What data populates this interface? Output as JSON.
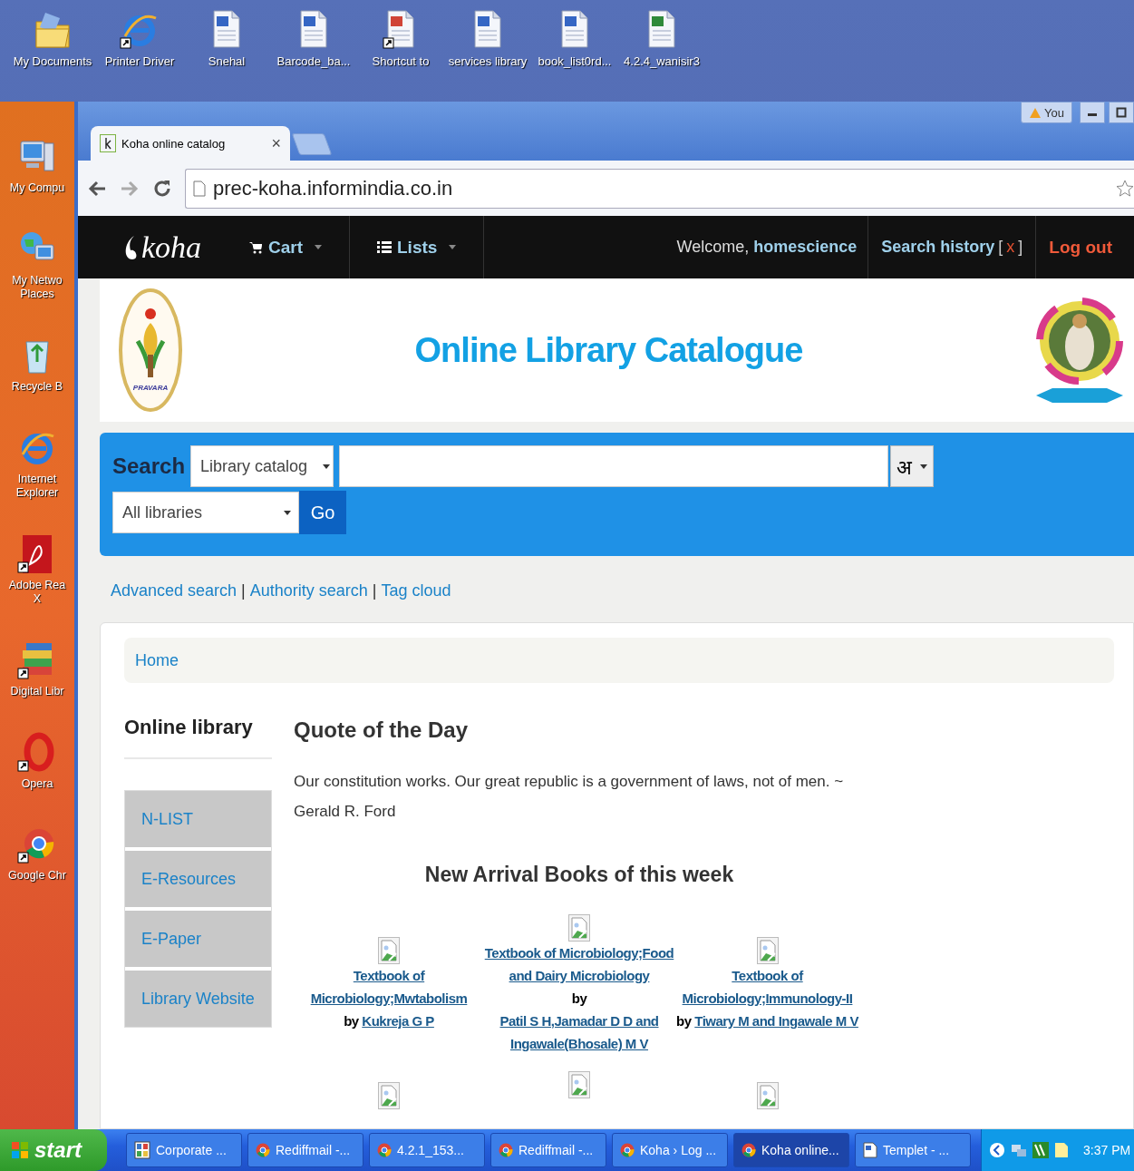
{
  "desktop": {
    "top_icons": [
      {
        "label": "My Documents",
        "kind": "folder",
        "shortcut": false
      },
      {
        "label": "Printer Driver",
        "kind": "ie",
        "shortcut": true
      },
      {
        "label": "Snehal",
        "kind": "word",
        "shortcut": false
      },
      {
        "label": "Barcode_ba...",
        "kind": "word",
        "shortcut": false
      },
      {
        "label": "Shortcut to",
        "kind": "ppt",
        "shortcut": true
      },
      {
        "label": "services library",
        "kind": "word",
        "shortcut": false
      },
      {
        "label": "book_list0rd...",
        "kind": "word",
        "shortcut": false
      },
      {
        "label": "4.2.4_wanisir3",
        "kind": "excel",
        "shortcut": false
      }
    ],
    "side_icons": [
      {
        "label": "My Compu",
        "kind": "computer",
        "shortcut": false
      },
      {
        "label": "My Netwo Places",
        "kind": "network",
        "shortcut": false
      },
      {
        "label": "Recycle B",
        "kind": "recycle",
        "shortcut": false
      },
      {
        "label": "Internet Explorer",
        "kind": "ie",
        "shortcut": false
      },
      {
        "label": "Adobe Rea X",
        "kind": "acrobat",
        "shortcut": true
      },
      {
        "label": "Digital Libr",
        "kind": "books",
        "shortcut": true
      },
      {
        "label": "Opera",
        "kind": "opera",
        "shortcut": true
      },
      {
        "label": "Google Chr",
        "kind": "chrome",
        "shortcut": true
      }
    ]
  },
  "browser": {
    "tab": {
      "title": "Koha online catalog",
      "close": "×",
      "selected": true
    },
    "profile": "You",
    "url": "prec-koha.informindia.co.in"
  },
  "navbar": {
    "logo": "koha",
    "menus": [
      {
        "label": "Cart",
        "kind": "cart"
      },
      {
        "label": "Lists",
        "kind": "list"
      }
    ],
    "welcome": "Welcome,",
    "user": "homescience",
    "search_history": "Search history",
    "history_open": "[",
    "history_clear": "x",
    "history_close": "]",
    "logout": "Log out"
  },
  "header": {
    "title": "Online Library Catalogue",
    "logo_text": "PRAVARA"
  },
  "search": {
    "label": "Search",
    "scope": "Library catalog",
    "keyboard": "अ",
    "library": "All libraries",
    "go": "Go"
  },
  "links": [
    {
      "kind": "link",
      "text": "Advanced search"
    },
    {
      "kind": "separator",
      "text": "|"
    },
    {
      "kind": "link",
      "text": "Authority search"
    },
    {
      "kind": "separator",
      "text": "|"
    },
    {
      "kind": "link",
      "text": "Tag cloud"
    }
  ],
  "breadcrumb": "Home",
  "sidebar": {
    "title": "Online library",
    "items": [
      "N-LIST",
      "E-Resources",
      "E-Paper",
      "Library Website"
    ]
  },
  "quote": {
    "title": "Quote of the Day",
    "text": "Our constitution works. Our great republic is a government of laws, not of men. ~ Gerald R. Ford"
  },
  "new_arrivals": {
    "title": "New Arrival Books of this week",
    "books": [
      {
        "title": "Textbook of Microbiology;Mwtabolism",
        "by": "by",
        "author": "Kukreja G P"
      },
      {
        "title": "Textbook of Microbiology;Food and Dairy Microbiology",
        "by": "by",
        "author": "Patil S H,Jamadar D D and Ingawale(Bhosale) M V"
      },
      {
        "title": "Textbook of Microbiology;Immunology-II",
        "by": "by",
        "author": "Tiwary M and Ingawale M V"
      }
    ]
  },
  "taskbar": {
    "start": "start",
    "items": [
      {
        "label": "Corporate ...",
        "kind": "app",
        "selected": false
      },
      {
        "label": "Rediffmail -...",
        "kind": "chrome",
        "selected": false
      },
      {
        "label": "4.2.1_153...",
        "kind": "chrome",
        "selected": false
      },
      {
        "label": "Rediffmail -...",
        "kind": "chrome",
        "selected": false
      },
      {
        "label": "Koha › Log ...",
        "kind": "chrome",
        "selected": false
      },
      {
        "label": "Koha online...",
        "kind": "chrome",
        "selected": true
      },
      {
        "label": "Templet - ...",
        "kind": "word",
        "selected": false
      }
    ],
    "clock": "3:37 PM"
  }
}
